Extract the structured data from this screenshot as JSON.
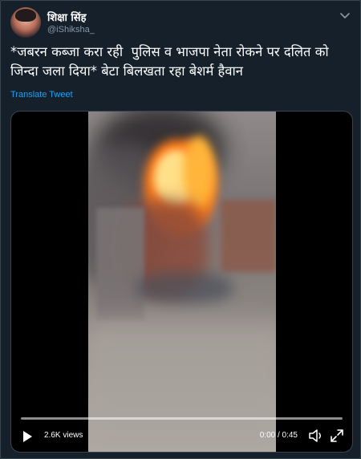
{
  "tweet": {
    "author_name": "शिक्षा सिंह",
    "author_handle": "@iShiksha_",
    "text": "*जबरन कब्जा करा रही  पुलिस व भाजपा नेता रोकने पर दलित को जिन्दा जला दिया* बेटा बिलखता रहा बेशर्म हैवान",
    "translate_label": "Translate Tweet"
  },
  "video": {
    "views_label": "2.6K views",
    "time_label": "0:00 / 0:45",
    "progress": 0.0,
    "accent_color": "#1da1f2"
  },
  "icons": {
    "menu": "chevron-down-icon",
    "play": "play-icon",
    "volume": "volume-icon",
    "fullscreen": "fullscreen-icon"
  },
  "colors": {
    "background": "#15202b",
    "border": "#38444d",
    "muted_text": "#8899a6",
    "link": "#1da1f2"
  }
}
